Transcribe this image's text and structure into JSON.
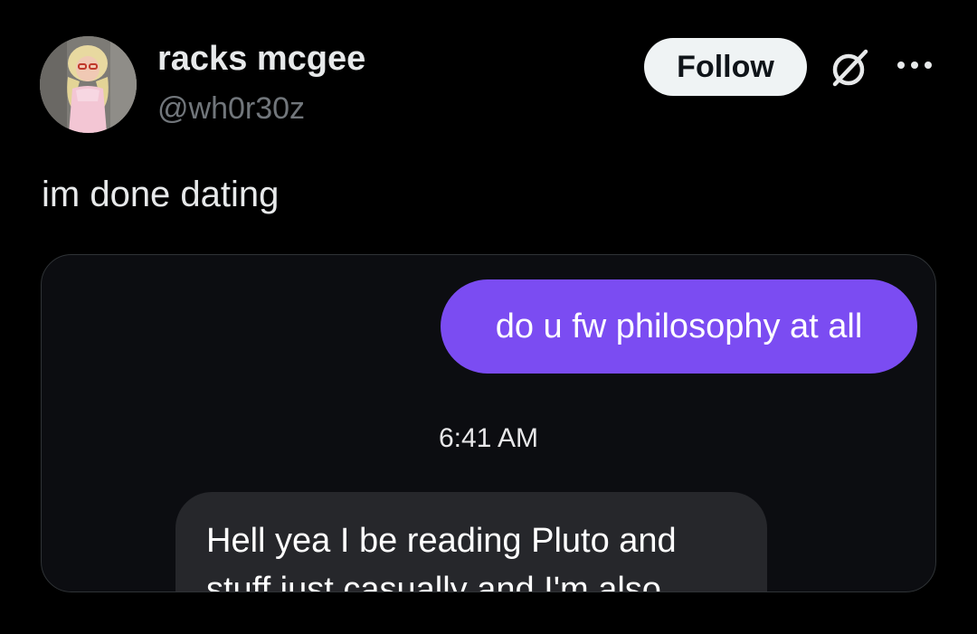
{
  "author": {
    "display_name": "racks mcgee",
    "handle": "@wh0r30z",
    "avatar_icon": "profile-photo"
  },
  "actions": {
    "follow_label": "Follow",
    "grok_icon": "grok-icon",
    "more_icon": "more-dots-icon"
  },
  "tweet": {
    "text": "im done dating"
  },
  "screenshot": {
    "sent_message": "do u fw philosophy at all",
    "timestamp": "6:41 AM",
    "received_message_lines": [
      "Hell yea I be reading Pluto and",
      "stuff just casually and I'm also"
    ]
  },
  "colors": {
    "background": "#000000",
    "sent_bubble": "#7b4cf2",
    "received_bubble": "#26272b",
    "follow_button": "#eff3f4",
    "handle_text": "#71767b"
  }
}
